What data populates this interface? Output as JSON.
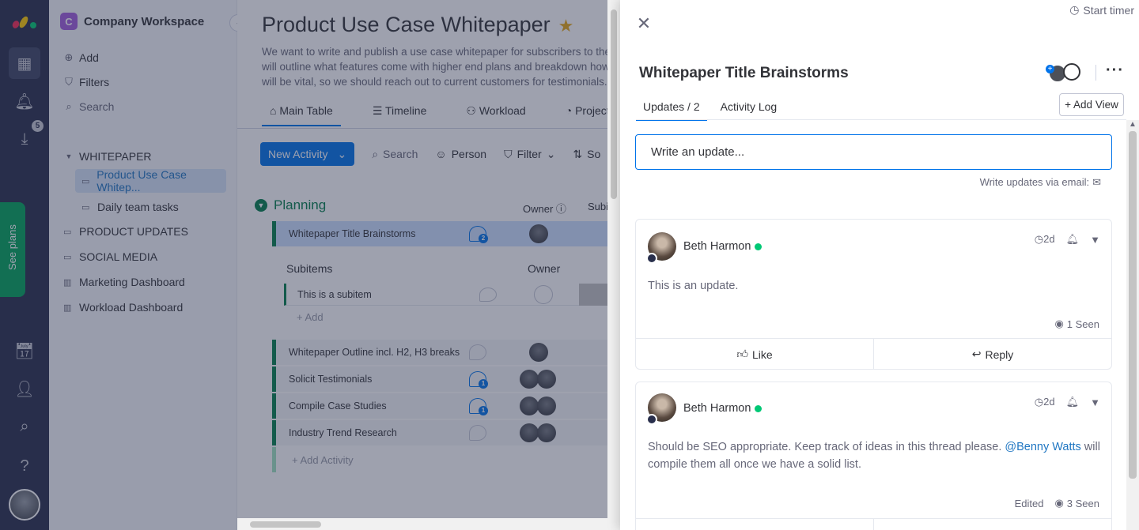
{
  "rail": {
    "download_badge": "5",
    "see_plans": "See plans"
  },
  "workspace": {
    "logo_letter": "C",
    "name": "Company Workspace",
    "add": "Add",
    "filters": "Filters",
    "search": "Search",
    "folder": "WHITEPAPER",
    "boards": [
      "Product Use Case Whitep...",
      "Daily team tasks",
      "PRODUCT UPDATES",
      "SOCIAL MEDIA",
      "Marketing Dashboard",
      "Workload Dashboard"
    ]
  },
  "board": {
    "title": "Product Use Case Whitepaper",
    "description": "We want to write and publish a use case whitepaper for subscribers to the b will outline what features come with higher end plans and breakdown how t will be vital, so we should reach out to current customers for testimonials.",
    "views": [
      "Main Table",
      "Timeline",
      "Workload",
      "Project Sta"
    ],
    "new_activity": "New Activity",
    "toolbar": {
      "search": "Search",
      "person": "Person",
      "filter": "Filter",
      "sort": "So"
    },
    "group": "Planning",
    "col_owner": "Owner",
    "col_sub": "Subi",
    "rows": [
      {
        "name": "Whitepaper Title Brainstorms",
        "updates": "2"
      },
      {
        "name": "Whitepaper Outline incl. H2, H3 breaks",
        "updates": ""
      },
      {
        "name": "Solicit Testimonials",
        "updates": "1"
      },
      {
        "name": "Compile Case Studies",
        "updates": "1"
      },
      {
        "name": "Industry Trend Research",
        "updates": ""
      }
    ],
    "subitems_header": "Subitems",
    "subitems_owner": "Owner",
    "subitem": "This is a subitem",
    "add_subitem": "+ Add",
    "add_activity": "+ Add Activity"
  },
  "panel": {
    "start_timer": "Start timer",
    "title": "Whitepaper Title Brainstorms",
    "tabs": [
      "Updates / 2",
      "Activity Log"
    ],
    "add_view": "+ Add View",
    "write_placeholder": "Write an update...",
    "via_email": "Write updates via email:",
    "updates": [
      {
        "author": "Beth Harmon",
        "time": "2d",
        "text": "This is an update.",
        "edited": "",
        "seen": "1 Seen"
      },
      {
        "author": "Beth Harmon",
        "time": "2d",
        "text_before": "Should be SEO appropriate. Keep track of ideas in this thread please. ",
        "mention": "@Benny Watts",
        "text_after": " will compile them all once we have a solid list.",
        "edited": "Edited",
        "seen": "3 Seen"
      }
    ],
    "like": "Like",
    "reply": "Reply"
  }
}
